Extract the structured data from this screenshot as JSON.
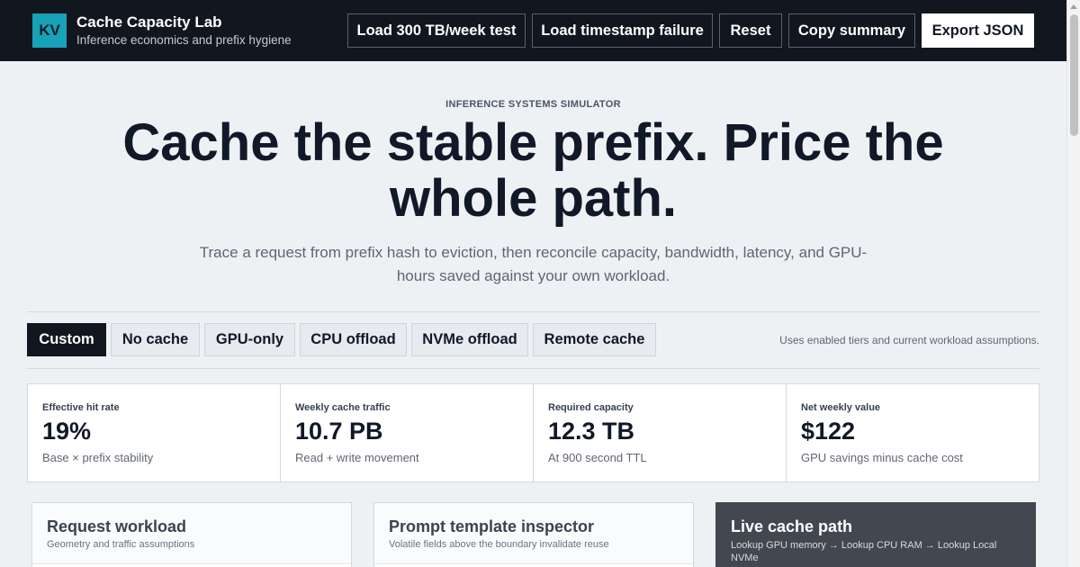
{
  "header": {
    "logo": "KV",
    "title": "Cache Capacity Lab",
    "subtitle": "Inference economics and prefix hygiene",
    "buttons": {
      "load_test": "Load 300 TB/week test",
      "load_failure": "Load timestamp failure",
      "reset": "Reset",
      "copy_summary": "Copy summary",
      "export_json": "Export JSON"
    }
  },
  "hero": {
    "eyebrow": "INFERENCE SYSTEMS SIMULATOR",
    "headline": "Cache the stable prefix. Price the whole path.",
    "lede": "Trace a request from prefix hash to eviction, then reconcile capacity, bandwidth, latency, and GPU-hours saved against your own workload."
  },
  "presets": {
    "tabs": [
      "Custom",
      "No cache",
      "GPU-only",
      "CPU offload",
      "NVMe offload",
      "Remote cache"
    ],
    "active": "Custom",
    "note": "Uses enabled tiers and current workload assumptions."
  },
  "metrics": [
    {
      "label": "Effective hit rate",
      "value": "19%",
      "sub": "Base × prefix stability"
    },
    {
      "label": "Weekly cache traffic",
      "value": "10.7 PB",
      "sub": "Read + write movement"
    },
    {
      "label": "Required capacity",
      "value": "12.3 TB",
      "sub": "At 900 second TTL"
    },
    {
      "label": "Net weekly value",
      "value": "$122",
      "sub": "GPU savings minus cache cost"
    }
  ],
  "panels": {
    "workload": {
      "title": "Request workload",
      "subtitle": "Geometry and traffic assumptions"
    },
    "inspector": {
      "title": "Prompt template inspector",
      "subtitle": "Volatile fields above the boundary invalidate reuse"
    },
    "live_path": {
      "title": "Live cache path",
      "subtitle": "Lookup GPU memory → Lookup CPU RAM → Lookup Local NVMe"
    }
  },
  "colors": {
    "topbar": "#12161f",
    "logo_accent": "#17a2b8",
    "page_bg": "#eef1f4",
    "dark_panel": "#434750"
  }
}
